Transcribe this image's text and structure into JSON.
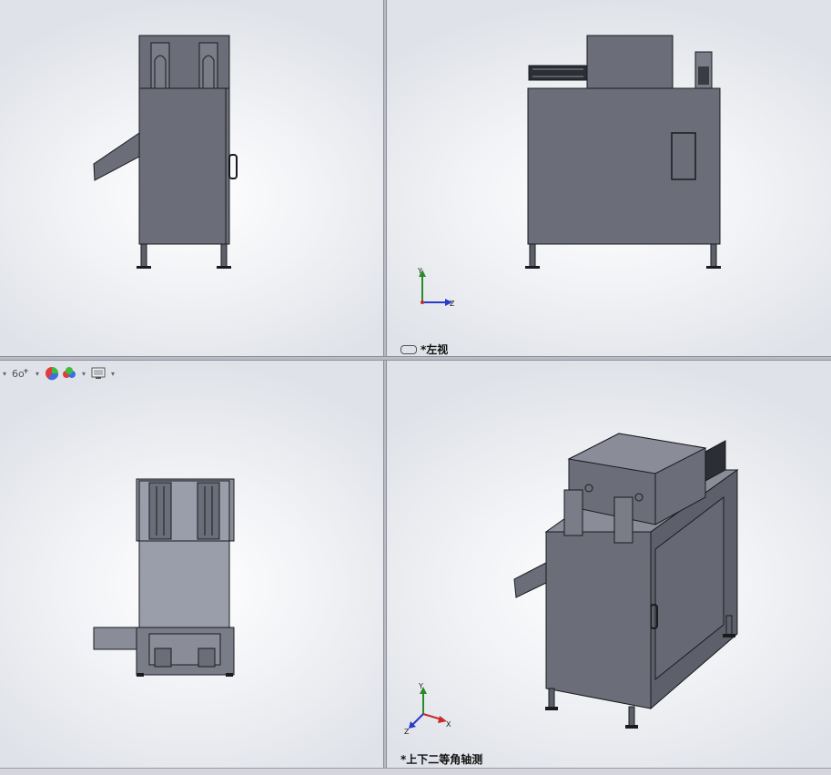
{
  "viewports": {
    "top_left": {
      "name": "front-view"
    },
    "top_right": {
      "name": "left-view",
      "label": "*左视"
    },
    "bottom_left": {
      "name": "top-view"
    },
    "bottom_right": {
      "name": "isometric-view",
      "label": "*上下二等角轴测"
    }
  },
  "triad_axes": {
    "y": "Y",
    "z": "Z",
    "x": "X"
  },
  "heads_up_toolbar": {
    "items": [
      "dropdown-arrow",
      "hide-show-items-icon",
      "edit-appearance-icon",
      "apply-scene-icon",
      "view-settings-icon"
    ]
  },
  "colors": {
    "model_fill": "#6b6e78",
    "model_edge": "#1a1b20",
    "model_light": "#8a8d97",
    "background": "#ffffff"
  }
}
